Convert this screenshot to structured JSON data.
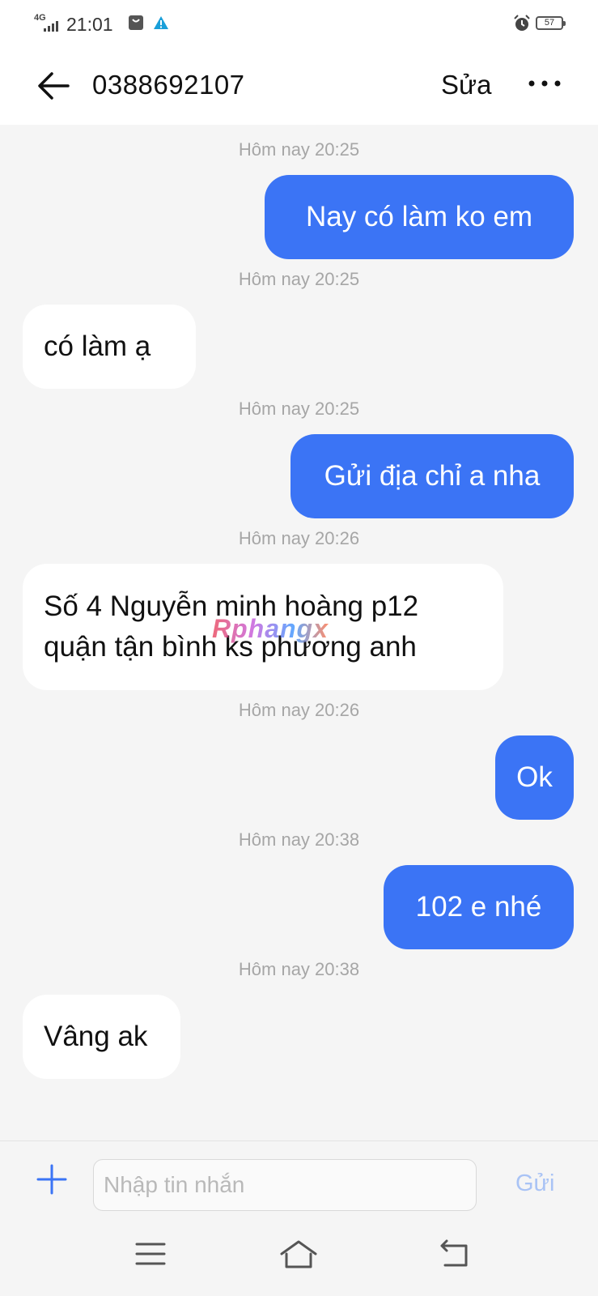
{
  "status_bar": {
    "network": "4G",
    "time": "21:01",
    "battery": "57",
    "icons": [
      "signal-icon",
      "notification-bag-icon",
      "warning-icon",
      "alarm-icon",
      "battery-icon"
    ]
  },
  "header": {
    "title": "0388692107",
    "edit_label": "Sửa",
    "icons": [
      "back-arrow-icon",
      "more-icon"
    ]
  },
  "messages": [
    {
      "timestamp": "Hôm nay 20:25",
      "direction": "sent",
      "lines": [
        "Nay có làm ko em"
      ]
    },
    {
      "timestamp": "Hôm nay 20:25",
      "direction": "received",
      "lines": [
        "có làm ạ"
      ]
    },
    {
      "timestamp": "Hôm nay 20:25",
      "direction": "sent",
      "lines": [
        "Gửi địa chỉ a nha"
      ]
    },
    {
      "timestamp": "Hôm nay 20:26",
      "direction": "received",
      "lines": [
        "Số 4 Nguyễn minh hoàng p12",
        "quận tận bình ks phương anh"
      ]
    },
    {
      "timestamp": "Hôm nay 20:26",
      "direction": "sent",
      "lines": [
        "Ok"
      ]
    },
    {
      "timestamp": "Hôm nay 20:38",
      "direction": "sent",
      "lines": [
        "102 e nhé"
      ]
    },
    {
      "timestamp": "Hôm nay 20:38",
      "direction": "received",
      "lines": [
        "Vâng ak"
      ]
    }
  ],
  "watermark": "Rphangx",
  "input": {
    "placeholder": "Nhập tin nhắn",
    "value": "",
    "send_label": "Gửi"
  },
  "colors": {
    "sent_bubble": "#3b74f5",
    "received_bubble": "#ffffff",
    "background": "#f5f5f5",
    "timestamp": "#a6a6a6",
    "send_disabled": "#a9c3f5",
    "accent": "#3b74f5"
  }
}
